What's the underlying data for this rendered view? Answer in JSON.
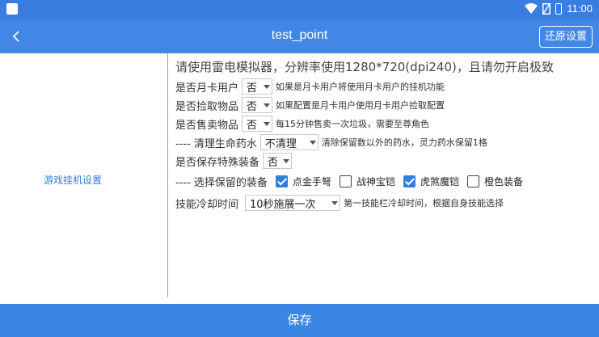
{
  "status_bar": {
    "time": "11:00"
  },
  "header": {
    "title": "test_point",
    "reset_label": "还原设置"
  },
  "sidebar": {
    "items": [
      {
        "label": "游戏挂机设置"
      }
    ]
  },
  "notice": "请使用雷电模拟器，分辨率使用1280*720(dpi240)，且请勿开启极致",
  "settings": {
    "monthly_user": {
      "label": "是否月卡用户",
      "value": "否",
      "desc": "如果是月卡用户将使用月卡用户的挂机功能"
    },
    "pickup": {
      "label": "是否捡取物品",
      "value": "否",
      "desc": "如果配置是月卡用户使用月卡用户捡取配置"
    },
    "sell": {
      "label": "是否售卖物品",
      "value": "否",
      "desc": "每15分钟售卖一次垃圾，需要至尊角色"
    },
    "potion": {
      "label": "---- 清理生命药水",
      "value": "不清理",
      "desc": "清除保留数以外的药水，灵力药水保留1格"
    },
    "special_gear": {
      "label": "是否保存特殊装备",
      "value": "否"
    },
    "keep_gear": {
      "label": "---- 选择保留的装备",
      "options": [
        {
          "label": "点金手弩",
          "checked": true
        },
        {
          "label": "战神宝铠",
          "checked": false
        },
        {
          "label": "虎煞魔铠",
          "checked": true
        },
        {
          "label": "橙色装备",
          "checked": false
        }
      ]
    },
    "cooldown": {
      "label": "技能冷却时间",
      "value": "10秒施展一次",
      "desc": "第一技能栏冷却时间，根据自身技能选择"
    }
  },
  "footer": {
    "save_label": "保存"
  },
  "colors": {
    "status_bar": "#3a7de0",
    "title_bar": "#4287e6",
    "accent": "#2f7fe0",
    "save_bar": "#3a86e5"
  }
}
